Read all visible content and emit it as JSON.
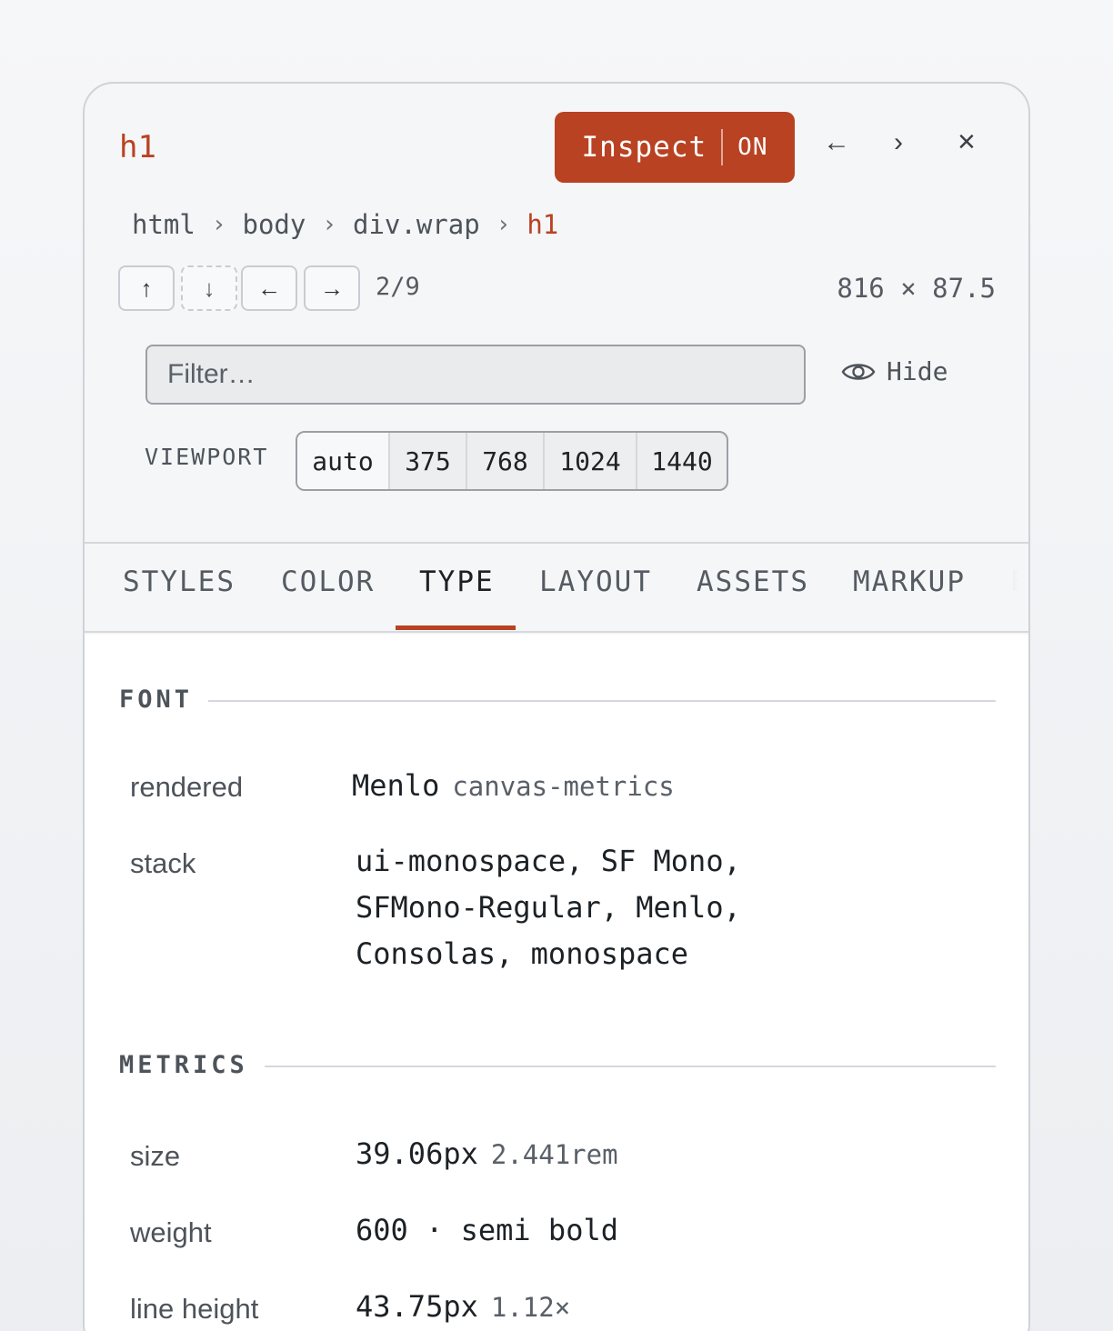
{
  "header": {
    "element_tag": "h1",
    "inspect_label": "Inspect",
    "inspect_state": "ON",
    "back_icon": "←",
    "forward_icon": "›",
    "close_icon": "×"
  },
  "breadcrumb": [
    "html",
    "body",
    "div.wrap",
    "h1"
  ],
  "breadcrumb_sep": "›",
  "nav": {
    "up": "↑",
    "down": "↓",
    "left": "←",
    "right": "→",
    "count": "2/9",
    "dimensions": "816 × 87.5"
  },
  "filter": {
    "placeholder": "Filter…",
    "value": ""
  },
  "hide_label": "Hide",
  "viewport": {
    "label": "VIEWPORT",
    "options": [
      "auto",
      "375",
      "768",
      "1024",
      "1440"
    ],
    "selected": "auto"
  },
  "tabs": [
    "STYLES",
    "COLOR",
    "TYPE",
    "LAYOUT",
    "ASSETS",
    "MARKUP",
    "E"
  ],
  "active_tab": "TYPE",
  "font_section": {
    "title": "FONT",
    "rendered_label": "rendered",
    "rendered_value": "Menlo",
    "rendered_note": "canvas-metrics",
    "stack_label": "stack",
    "stack_lines": [
      "ui-monospace, SF Mono,",
      "SFMono-Regular, Menlo,",
      "Consolas, monospace"
    ]
  },
  "metrics_section": {
    "title": "METRICS",
    "size_label": "size",
    "size_value": "39.06px",
    "size_note": "2.441rem",
    "weight_label": "weight",
    "weight_value": "600 · semi bold",
    "line_height_label": "line height",
    "line_height_value": "43.75px",
    "line_height_note": "1.12×"
  },
  "colors": {
    "accent": "#b94222",
    "text": "#1c2126",
    "muted": "#4d535a"
  }
}
